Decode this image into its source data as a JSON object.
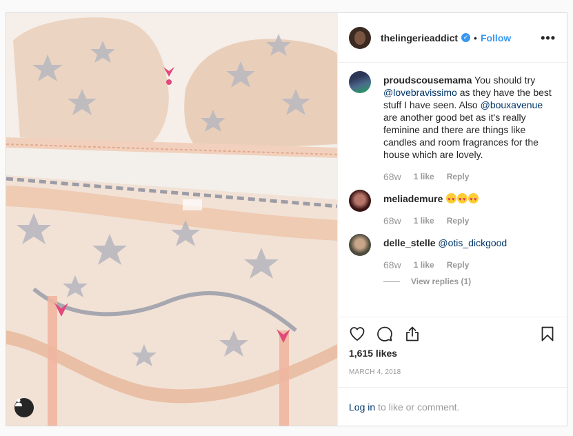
{
  "header": {
    "username": "thelingerieaddict",
    "verified_glyph": "✓",
    "separator": "•",
    "follow_label": "Follow",
    "more_glyph": "•••"
  },
  "comments": [
    {
      "username": "proudscousemama",
      "text_before": "You should try",
      "mention1": "@lovebravissimo",
      "text_middle": "as they have the best stuff I have seen. Also",
      "mention2": "@bouxavenue",
      "text_after": "are another good bet as it's really feminine and there are things like candles and room fragrances for the house which are lovely.",
      "time": "68w",
      "likes": "1 like",
      "reply": "Reply",
      "avatar_color": "#3e4a6e"
    },
    {
      "username": "meliademure",
      "emoji_count": 3,
      "time": "68w",
      "likes": "1 like",
      "reply": "Reply",
      "avatar_color": "#5a1f1f"
    },
    {
      "username": "delle_stelle",
      "mention": "@otis_dickgood",
      "time": "68w",
      "likes": "1 like",
      "reply": "Reply",
      "view_replies": "View replies (1)",
      "avatar_color": "#4b4a3c"
    }
  ],
  "actions": {
    "icons": [
      "heart-icon",
      "comment-icon",
      "share-icon",
      "bookmark-icon"
    ]
  },
  "likes": "1,615 likes",
  "date": "MARCH 4, 2018",
  "login": {
    "link": "Log in",
    "text": "to like or comment."
  },
  "colors": {
    "link": "#3897f0",
    "mention": "#003569",
    "muted": "#999999"
  }
}
